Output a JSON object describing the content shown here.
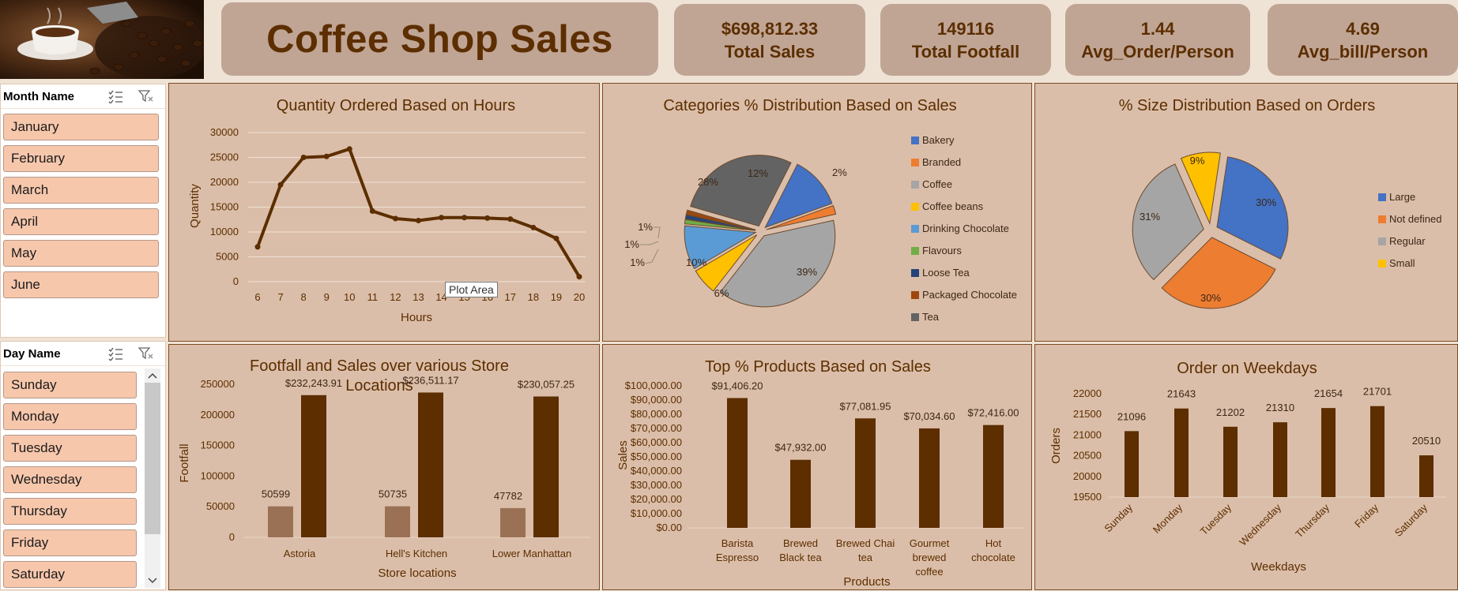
{
  "header": {
    "title": "Coffee Shop Sales",
    "kpis": [
      {
        "value": "$698,812.33",
        "label": "Total Sales"
      },
      {
        "value": "149116",
        "label": "Total Footfall"
      },
      {
        "value": "1.44",
        "label": "Avg_Order/Person"
      },
      {
        "value": "4.69",
        "label": "Avg_bill/Person"
      }
    ]
  },
  "slicers": {
    "month": {
      "title": "Month Name",
      "items": [
        "January",
        "February",
        "March",
        "April",
        "May",
        "June"
      ]
    },
    "day": {
      "title": "Day Name",
      "items": [
        "Sunday",
        "Monday",
        "Tuesday",
        "Wednesday",
        "Thursday",
        "Friday",
        "Saturday"
      ]
    }
  },
  "tooltip": "Plot Area",
  "colors": {
    "accent": "#5c2e00",
    "panel": "#dbbea9",
    "kpi": "#c0a595",
    "slicer_item": "#f7c7ac",
    "bar_light": "#9b7155"
  },
  "chart_data": [
    {
      "type": "line",
      "title": "Quantity Ordered Based on Hours",
      "xlabel": "Hours",
      "ylabel": "Quantity",
      "x": [
        6,
        7,
        8,
        9,
        10,
        11,
        12,
        13,
        14,
        15,
        16,
        17,
        18,
        19,
        20
      ],
      "x_labels": [
        "6",
        "7",
        "8",
        "9",
        "10",
        "11",
        "12",
        "13",
        "14",
        "15",
        "16",
        "17",
        "18",
        "19",
        "20"
      ],
      "y_ticks": [
        "0",
        "5000",
        "10000",
        "15000",
        "20000",
        "25000",
        "30000"
      ],
      "values": [
        7000,
        19500,
        25000,
        25200,
        26700,
        14200,
        12700,
        12300,
        12900,
        12900,
        12800,
        12600,
        10900,
        8700,
        1000
      ],
      "ylim": [
        0,
        30000
      ],
      "grid": true
    },
    {
      "type": "pie",
      "title": "Categories % Distribution Based on Sales",
      "legend": "right",
      "labels": [
        "Bakery",
        "Branded",
        "Coffee",
        "Coffee beans",
        "Drinking Chocolate",
        "Flavours",
        "Loose Tea",
        "Packaged Chocolate",
        "Tea"
      ],
      "values": [
        12,
        2,
        39,
        6,
        10,
        1,
        1,
        1,
        28
      ],
      "data_labels": [
        "12%",
        "2%",
        "39%",
        "6%",
        "10%",
        "1%",
        "1%",
        "1%",
        "28%"
      ],
      "colors": [
        "#4472c4",
        "#ed7d31",
        "#a5a5a5",
        "#ffc000",
        "#5b9bd5",
        "#70ad47",
        "#264478",
        "#9e480e",
        "#636363"
      ]
    },
    {
      "type": "pie",
      "title": "% Size Distribution Based on Orders",
      "legend": "right",
      "labels": [
        "Large",
        "Not defined",
        "Regular",
        "Small"
      ],
      "values": [
        30,
        30,
        31,
        9
      ],
      "data_labels": [
        "30%",
        "30%",
        "31%",
        "9%"
      ],
      "colors": [
        "#4472c4",
        "#ed7d31",
        "#a5a5a5",
        "#ffc000"
      ]
    },
    {
      "type": "bar",
      "title": "Footfall and Sales over various Store Locations",
      "xlabel": "Store locations",
      "ylabel": "Footfall",
      "categories": [
        "Astoria",
        "Hell's Kitchen",
        "Lower Manhattan"
      ],
      "series": [
        {
          "values": [
            50599,
            50735,
            47782
          ],
          "data_labels": [
            "50599",
            "50735",
            "47782"
          ],
          "color": "#9b7155"
        },
        {
          "values": [
            232243.91,
            236511.17,
            230057.25
          ],
          "data_labels": [
            "$232,243.91",
            "$236,511.17",
            "$230,057.25"
          ],
          "color": "#5c2e00"
        }
      ],
      "y_ticks": [
        "0",
        "50000",
        "100000",
        "150000",
        "200000",
        "250000"
      ],
      "ylim": [
        0,
        250000
      ]
    },
    {
      "type": "bar",
      "title": "Top % Products Based on Sales",
      "xlabel": "Products",
      "ylabel": "Sales",
      "categories": [
        "Barista Espresso",
        "Brewed Black tea",
        "Brewed Chai tea",
        "Gourmet brewed coffee",
        "Hot chocolate"
      ],
      "category_lines": [
        [
          "Barista",
          "Espresso"
        ],
        [
          "Brewed",
          "Black tea"
        ],
        [
          "Brewed Chai",
          "tea"
        ],
        [
          "Gourmet",
          "brewed",
          "coffee"
        ],
        [
          "Hot",
          "chocolate"
        ]
      ],
      "values": [
        91406.2,
        47932.0,
        77081.95,
        70034.6,
        72416.0
      ],
      "data_labels": [
        "$91,406.20",
        "$47,932.00",
        "$77,081.95",
        "$70,034.60",
        "$72,416.00"
      ],
      "y_ticks": [
        "$0.00",
        "$10,000.00",
        "$20,000.00",
        "$30,000.00",
        "$40,000.00",
        "$50,000.00",
        "$60,000.00",
        "$70,000.00",
        "$80,000.00",
        "$90,000.00",
        "$100,000.00"
      ],
      "ylim": [
        0,
        100000
      ]
    },
    {
      "type": "bar",
      "title": "Order on Weekdays",
      "xlabel": "Weekdays",
      "ylabel": "Orders",
      "categories": [
        "Sunday",
        "Monday",
        "Tuesday",
        "Wednesday",
        "Thursday",
        "Friday",
        "Saturday"
      ],
      "values": [
        21096,
        21643,
        21202,
        21310,
        21654,
        21701,
        20510
      ],
      "data_labels": [
        "21096",
        "21643",
        "21202",
        "21310",
        "21654",
        "21701",
        "20510"
      ],
      "y_ticks": [
        "19500",
        "20000",
        "20500",
        "21000",
        "21500",
        "22000"
      ],
      "ylim": [
        19500,
        22000
      ]
    }
  ]
}
